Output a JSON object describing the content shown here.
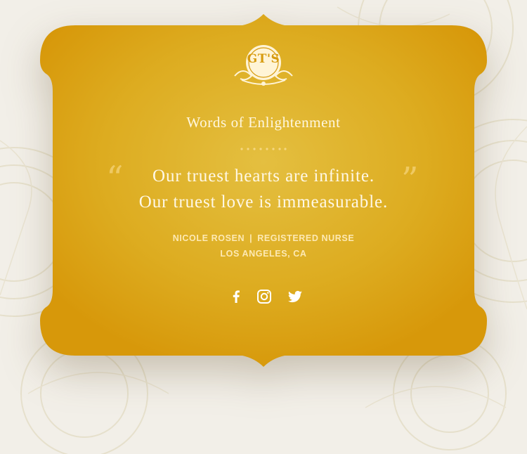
{
  "colors": {
    "card_center": "#e4bc3d",
    "card_edge": "#d79a0c",
    "text_light": "#fff8e6",
    "quote_mark": "#f3cf6f",
    "background": "#f2efe8"
  },
  "logo": {
    "text": "GT'S"
  },
  "header": {
    "title": "Words of Enlightenment"
  },
  "quote": {
    "open_mark": "“",
    "close_mark": "”",
    "line1": "Our truest hearts are infinite.",
    "line2": "Our truest love is immeasurable."
  },
  "attribution": {
    "name": "NICOLE ROSEN",
    "separator": "|",
    "role": "REGISTERED NURSE",
    "location": "LOS ANGELES, CA"
  },
  "social": [
    {
      "icon": "facebook-icon"
    },
    {
      "icon": "instagram-icon"
    },
    {
      "icon": "twitter-icon"
    }
  ]
}
